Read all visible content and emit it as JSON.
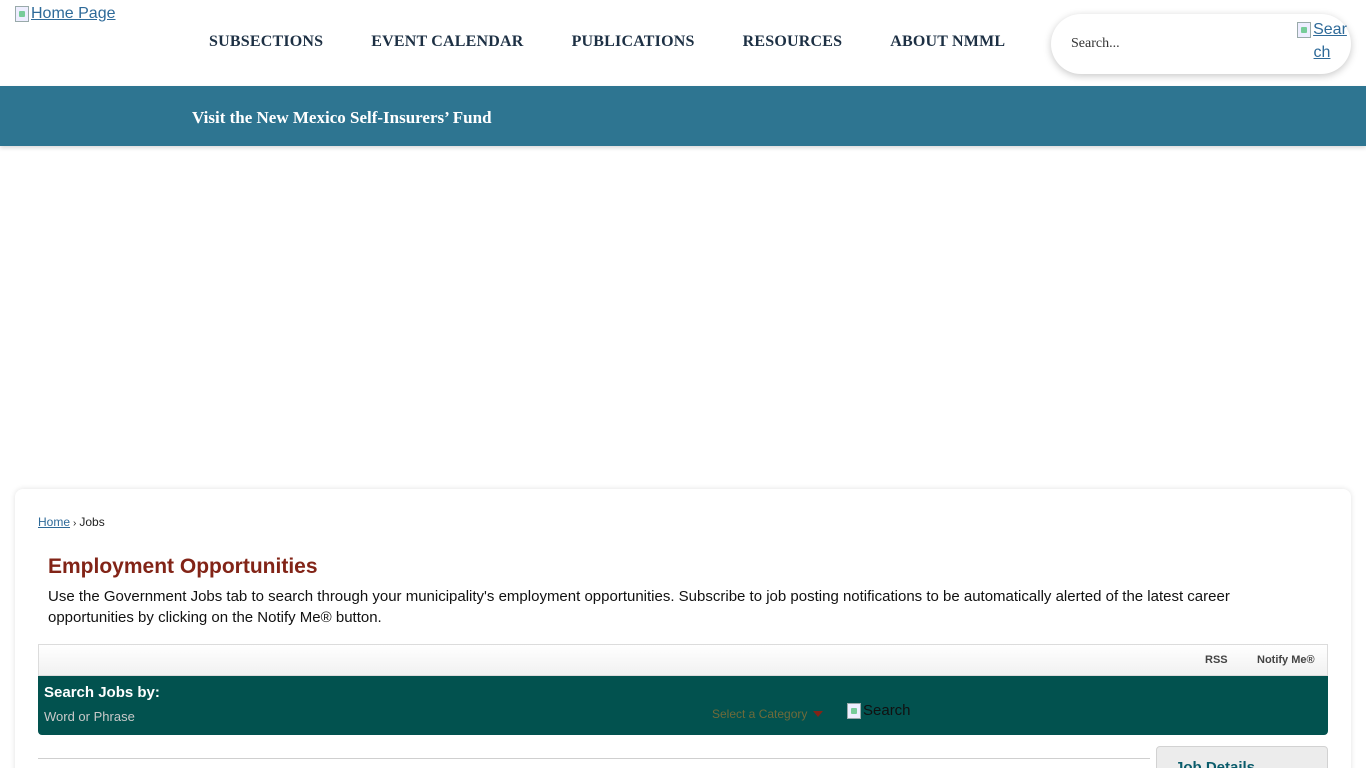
{
  "header": {
    "logo_alt": "Home Page",
    "nav": [
      "SUBSECTIONS",
      "EVENT CALENDAR",
      "PUBLICATIONS",
      "RESOURCES",
      "ABOUT NMML"
    ],
    "search_placeholder": "Search...",
    "search_button_alt": "Search"
  },
  "banner": {
    "link_text": "Visit the New Mexico Self-Insurers’ Fund"
  },
  "content": {
    "breadcrumb": {
      "home": "Home",
      "separator": "›",
      "current": "Jobs"
    },
    "title": "Employment Opportunities",
    "intro": "Use the Government Jobs tab to search through your municipality's employment opportunities. Subscribe to job posting notifications to be automatically alerted of the latest career opportunities by clicking on the Notify Me® button.",
    "tools": {
      "rss": "RSS",
      "notify": "Notify Me®"
    },
    "search_jobs": {
      "label": "Search Jobs by:",
      "word_placeholder": "Word or Phrase",
      "category_placeholder": "Select a Category",
      "search_button_alt": "Search"
    },
    "job_details_title": "Job Details"
  },
  "colors": {
    "nav_text": "#1d3044",
    "banner_bg": "#2e7591",
    "title": "#822417",
    "search_bar_bg": "#02524f",
    "link": "#2e6a99"
  }
}
